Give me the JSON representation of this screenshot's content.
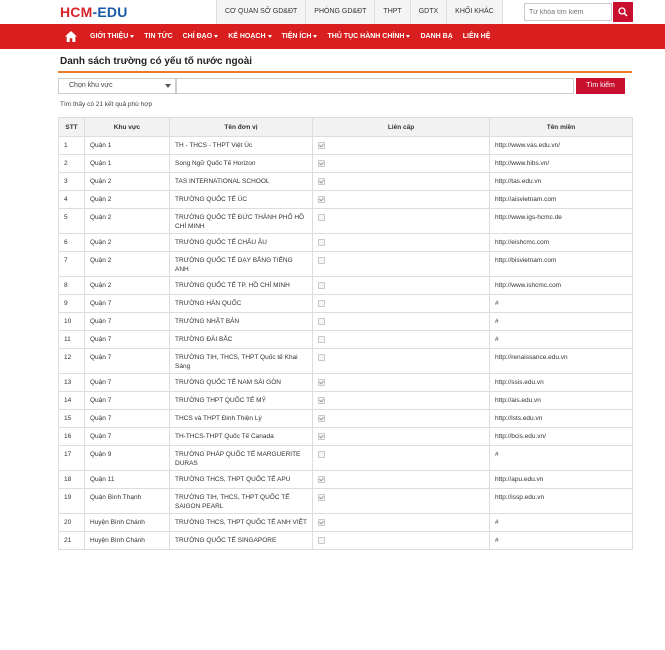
{
  "logo": {
    "part1": "HCM",
    "part2": "-EDU"
  },
  "top_links": [
    "CƠ QUAN SỞ GD&ĐT",
    "PHÒNG GD&ĐT",
    "THPT",
    "GDTX",
    "KHỐI KHÁC"
  ],
  "top_search": {
    "placeholder": "Từ khóa tìm kiếm",
    "icon": "search-icon"
  },
  "nav": {
    "home_icon": "home-icon",
    "items": [
      {
        "label": "GIỚI THIỆU",
        "dropdown": true
      },
      {
        "label": "TIN TỨC",
        "dropdown": false
      },
      {
        "label": "CHỈ ĐẠO",
        "dropdown": true
      },
      {
        "label": "KẾ HOẠCH",
        "dropdown": true
      },
      {
        "label": "TIỆN ÍCH",
        "dropdown": true
      },
      {
        "label": "THỦ TỤC HÀNH CHÍNH",
        "dropdown": true
      },
      {
        "label": "DANH BẠ",
        "dropdown": false
      },
      {
        "label": "LIÊN HỆ",
        "dropdown": false
      }
    ]
  },
  "page_title": "Danh sách trường có yếu tố nước ngoài",
  "filter": {
    "select_value": "Chọn khu vực",
    "search_button": "Tìm kiếm"
  },
  "result_text": "Tìm thấy có 21 kết quả phù hợp",
  "table": {
    "headers": [
      "STT",
      "Khu vực",
      "Tên đơn vị",
      "Liên cấp",
      "Tên miền"
    ],
    "rows": [
      {
        "stt": "1",
        "area": "Quận 1",
        "name": "TH - THCS - THPT Việt Úc",
        "lien_cap": true,
        "domain": "http://www.vas.edu.vn/"
      },
      {
        "stt": "2",
        "area": "Quận 1",
        "name": "Song Ngữ Quốc Tế Horizon",
        "lien_cap": true,
        "domain": "http://www.hibs.vn/"
      },
      {
        "stt": "3",
        "area": "Quận 2",
        "name": "TAS INTERNATIONAL SCHOOL",
        "lien_cap": true,
        "domain": "http://tas.edu.vn"
      },
      {
        "stt": "4",
        "area": "Quận 2",
        "name": "TRƯỜNG QUỐC TẾ ÚC",
        "lien_cap": true,
        "domain": "http://aisvietnam.com"
      },
      {
        "stt": "5",
        "area": "Quận 2",
        "name": "TRƯỜNG QUỐC TẾ ĐỨC THÀNH PHỐ HỒ CHÍ MINH",
        "lien_cap": false,
        "domain": "http://www.igs-hcmc.de"
      },
      {
        "stt": "6",
        "area": "Quận 2",
        "name": "TRƯỜNG QUỐC TẾ CHÂU ÂU",
        "lien_cap": false,
        "domain": "http://eishcmc.com"
      },
      {
        "stt": "7",
        "area": "Quận 2",
        "name": "TRƯỜNG QUỐC TẾ DẠY BẰNG TIẾNG ANH",
        "lien_cap": false,
        "domain": "http://bisvietnam.com"
      },
      {
        "stt": "8",
        "area": "Quận 2",
        "name": "TRƯỜNG QUỐC TẾ TP. HỒ CHÍ MINH",
        "lien_cap": false,
        "domain": "http://www.ishcmc.com"
      },
      {
        "stt": "9",
        "area": "Quận 7",
        "name": "TRƯỜNG HÀN QUỐC",
        "lien_cap": false,
        "domain": "#"
      },
      {
        "stt": "10",
        "area": "Quận 7",
        "name": "TRƯỜNG NHẬT BẢN",
        "lien_cap": false,
        "domain": "#"
      },
      {
        "stt": "11",
        "area": "Quận 7",
        "name": "TRƯỜNG ĐÀI BẮC",
        "lien_cap": false,
        "domain": "#"
      },
      {
        "stt": "12",
        "area": "Quận 7",
        "name": "TRƯỜNG TIH, THCS, THPT Quốc tế Khai Sáng",
        "lien_cap": false,
        "domain": "http://renaissance.edu.vn"
      },
      {
        "stt": "13",
        "area": "Quận 7",
        "name": "TRƯỜNG QUỐC TẾ NAM SÀI GÒN",
        "lien_cap": true,
        "domain": "http://ssis.edu.vn"
      },
      {
        "stt": "14",
        "area": "Quận 7",
        "name": "TRƯỜNG THPT QUỐC TẾ MỸ",
        "lien_cap": true,
        "domain": "http://ais.edu.vn"
      },
      {
        "stt": "15",
        "area": "Quận 7",
        "name": "THCS và THPT Đinh Thiện Lý",
        "lien_cap": true,
        "domain": "http://lsts.edu.vn"
      },
      {
        "stt": "16",
        "area": "Quận 7",
        "name": "TH-THCS-THPT Quốc Tế Canada",
        "lien_cap": true,
        "domain": "http://bcis.edu.vn/"
      },
      {
        "stt": "17",
        "area": "Quận 9",
        "name": "TRƯỜNG PHÁP QUỐC TẾ MARGUERITE DURAS",
        "lien_cap": false,
        "domain": "#"
      },
      {
        "stt": "18",
        "area": "Quận 11",
        "name": "TRƯỜNG THCS, THPT QUỐC TẾ APU",
        "lien_cap": true,
        "domain": "http://apu.edu.vn"
      },
      {
        "stt": "19",
        "area": "Quận Bình Thạnh",
        "name": "TRƯỜNG TIH, THCS, THPT QUỐC TẾ SAIGON PEARL",
        "lien_cap": true,
        "domain": "http://issp.edu.vn"
      },
      {
        "stt": "20",
        "area": "Huyện Bình Chánh",
        "name": "TRƯỜNG THCS, THPT QUỐC TẾ ANH VIỆT",
        "lien_cap": true,
        "domain": "#"
      },
      {
        "stt": "21",
        "area": "Huyện Bình Chánh",
        "name": "TRƯỜNG QUỐC TẾ SINGAPORE",
        "lien_cap": false,
        "domain": "#"
      }
    ]
  }
}
